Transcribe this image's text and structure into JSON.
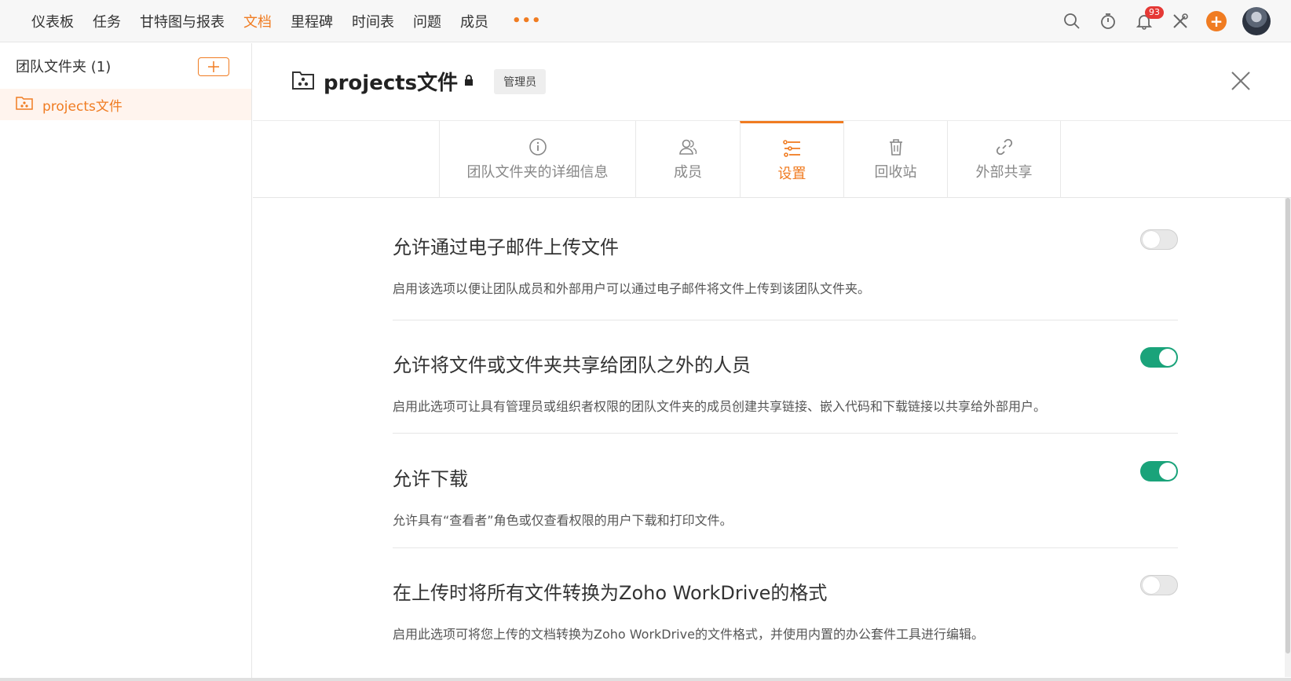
{
  "nav": {
    "items": [
      "仪表板",
      "任务",
      "甘特图与报表",
      "文档",
      "里程碑",
      "时间表",
      "问题",
      "成员"
    ],
    "more": "•••",
    "notification_count": "93",
    "icons": [
      "search-icon",
      "timer-icon",
      "bell-icon",
      "tools-icon",
      "plus-icon",
      "avatar"
    ]
  },
  "sidebar": {
    "title": "团队文件夹 (1)",
    "items": [
      {
        "label": "projects文件",
        "active": true
      }
    ]
  },
  "header": {
    "title": "projects文件",
    "role": "管理员"
  },
  "tabs": [
    {
      "label": "团队文件夹的详细信息",
      "icon": "info-icon"
    },
    {
      "label": "成员",
      "icon": "members-icon"
    },
    {
      "label": "设置",
      "icon": "settings-sliders-icon",
      "active": true
    },
    {
      "label": "回收站",
      "icon": "trash-icon"
    },
    {
      "label": "外部共享",
      "icon": "link-icon"
    }
  ],
  "settings": [
    {
      "title": "允许通过电子邮件上传文件",
      "desc": "启用该选项以便让团队成员和外部用户可以通过电子邮件将文件上传到该团队文件夹。",
      "enabled": false
    },
    {
      "title": "允许将文件或文件夹共享给团队之外的人员",
      "desc": "启用此选项可让具有管理员或组织者权限的团队文件夹的成员创建共享链接、嵌入代码和下载链接以共享给外部用户。",
      "enabled": true
    },
    {
      "title": "允许下载",
      "desc": "允许具有“查看者”角色或仅查看权限的用户下载和打印文件。",
      "enabled": true
    },
    {
      "title": "在上传时将所有文件转换为Zoho WorkDrive的格式",
      "desc": "启用此选项可将您上传的文档转换为Zoho WorkDrive的文件格式，并使用内置的办公套件工具进行编辑。",
      "enabled": false
    }
  ],
  "colors": {
    "accent": "#f07c22",
    "toggle_on": "#1aa37a",
    "active_bg": "#fff4ee"
  }
}
